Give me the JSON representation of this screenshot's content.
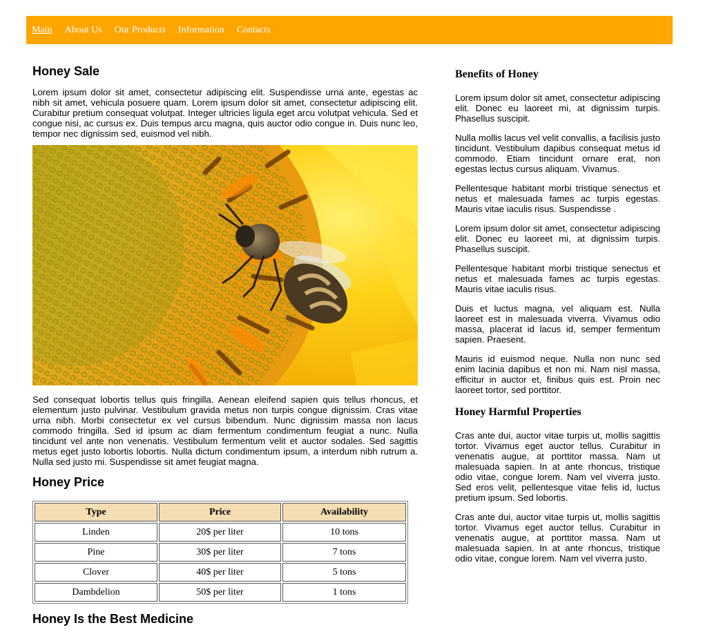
{
  "nav": {
    "items": [
      {
        "label": "Main",
        "active": true
      },
      {
        "label": "About Us",
        "active": false
      },
      {
        "label": "Our Products",
        "active": false
      },
      {
        "label": "Information",
        "active": false
      },
      {
        "label": "Contacts",
        "active": false
      }
    ]
  },
  "colors": {
    "nav_bg": "#ffa500",
    "table_header_bg": "#f5deb3"
  },
  "main": {
    "title": "Honey Sale",
    "intro": "Lorem ipsum dolor sit amet, consectetur adipiscing elit. Suspendisse urna ante, egestas ac nibh sit amet, vehicula posuere quam. Lorem ipsum dolor sit amet, consectetur adipiscing elit. Curabitur pretium consequat volutpat. Integer ultricies ligula eget arcu volutpat vehicula. Sed et congue nisi, ac cursus ex. Duis tempus arcu magna, quis auctor odio congue in. Duis nunc leo, tempor nec dignissim sed, euismod vel nibh.",
    "image": "bee on sunflower",
    "body": "Sed consequat lobortis tellus quis fringilla. Aenean eleifend sapien quis tellus rhoncus, et elementum justo pulvinar. Vestibulum gravida metus non turpis congue dignissim. Cras vitae urna nibh. Morbi consectetur ex vel cursus bibendum. Nunc dignissim massa non lacus commodo fringilla. Sed id ipsum ac diam fermentum condimentum feugiat a nunc. Nulla tincidunt vel ante non venenatis. Vestibulum fermentum velit et auctor sodales. Sed sagittis metus eget justo lobortis lobortis. Nulla dictum condimentum ipsum, a interdum nibh rutrum a. Nulla sed justo mi. Suspendisse sit amet feugiat magna.",
    "price_title": "Honey Price",
    "table": {
      "headers": [
        "Type",
        "Price",
        "Availability"
      ],
      "rows": [
        [
          "Linden",
          "20$ per liter",
          "10 tons"
        ],
        [
          "Pine",
          "30$ per liter",
          "7 tons"
        ],
        [
          "Clover",
          "40$ per liter",
          "5 tons"
        ],
        [
          "Dambdelion",
          "50$ per liter",
          "1 tons"
        ]
      ]
    },
    "medicine_title": "Honey Is the Best Medicine"
  },
  "sidebar": {
    "benefits_title": "Benefits of Honey",
    "benefits": [
      "Lorem ipsum dolor sit amet, consectetur adipiscing elit. Donec eu laoreet mi, at dignissim turpis. Phasellus suscipit.",
      "Nulla mollis lacus vel velit convallis, a facilisis justo tincidunt. Vestibulum dapibus consequat metus id commodo. Etiam tincidunt ornare erat, non egestas lectus cursus aliquam. Vivamus.",
      "Pellentesque habitant morbi tristique senectus et netus et malesuada fames ac turpis egestas. Mauris vitae iaculis risus. Suspendisse .",
      "Lorem ipsum dolor sit amet, consectetur adipiscing elit. Donec eu laoreet mi, at dignissim turpis. Phasellus suscipit.",
      "Pellentesque habitant morbi tristique senectus et netus et malesuada fames ac turpis egestas. Mauris vitae iaculis risus.",
      "Duis et luctus magna, vel aliquam est. Nulla laoreet est in malesuada viverra. Vivamus odio massa, placerat id lacus id, semper fermentum sapien. Praesent.",
      "Mauris id euismod neque. Nulla non nunc sed enim lacinia dapibus et non mi. Nam nisl massa, efficitur in auctor et, finibus quis est. Proin nec laoreet tortor, sed porttitor."
    ],
    "harmful_title": "Honey Harmful Properties",
    "harmful": [
      "Cras ante dui, auctor vitae turpis ut, mollis sagittis tortor. Vivamus eget auctor tellus. Curabitur in venenatis augue, at porttitor massa. Nam ut malesuada sapien. In at ante rhoncus, tristique odio vitae, congue lorem. Nam vel viverra justo. Sed eros velit, pellentesque vitae felis id, luctus pretium ipsum. Sed lobortis.",
      "Cras ante dui, auctor vitae turpis ut, mollis sagittis tortor. Vivamus eget auctor tellus. Curabitur in venenatis augue, at porttitor massa. Nam ut malesuada sapien. In at ante rhoncus, tristique odio vitae, congue lorem. Nam vel viverra justo."
    ]
  }
}
